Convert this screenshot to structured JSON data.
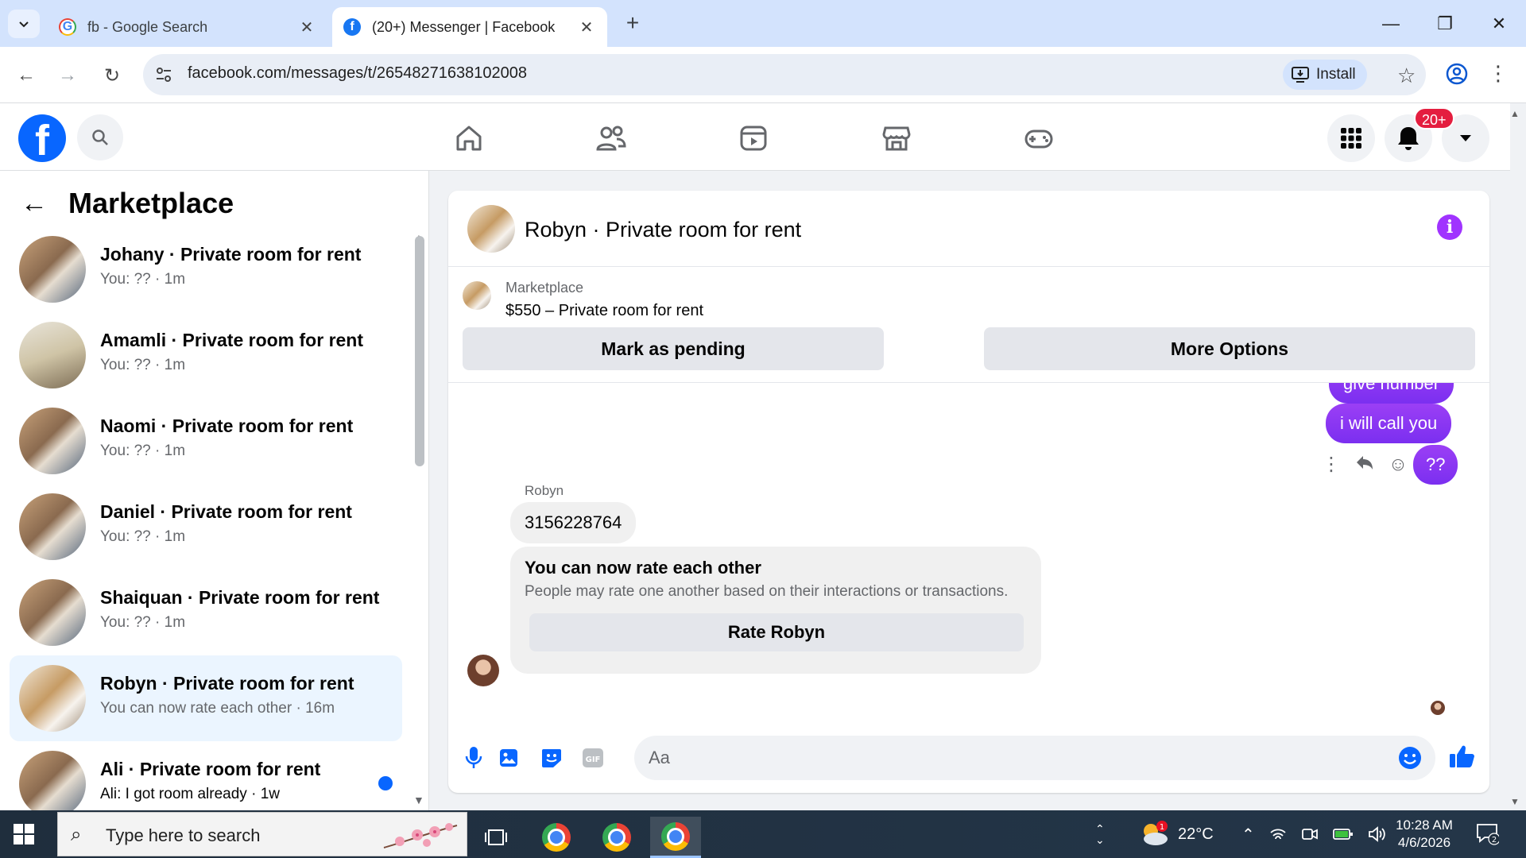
{
  "browser": {
    "tabs": [
      {
        "title": "fb - Google Search",
        "active": false
      },
      {
        "title": "(20+) Messenger | Facebook",
        "active": true
      }
    ],
    "url": "facebook.com/messages/t/26548271638102008",
    "install_label": "Install"
  },
  "fb_nav": {
    "notification_badge": "20+",
    "brand_color": "#0866ff"
  },
  "sidebar": {
    "title": "Marketplace",
    "conversations": [
      {
        "name": "Johany · Private room for rent",
        "preview": "You: ?? · 1m",
        "selected": false,
        "unread": false
      },
      {
        "name": "Amamli · Private room for rent",
        "preview": "You: ?? · 1m",
        "selected": false,
        "unread": false
      },
      {
        "name": "Naomi · Private room for rent",
        "preview": "You: ?? · 1m",
        "selected": false,
        "unread": false
      },
      {
        "name": "Daniel · Private room for rent",
        "preview": "You: ?? · 1m",
        "selected": false,
        "unread": false
      },
      {
        "name": "Shaiquan · Private room for rent",
        "preview": "You: ?? · 1m",
        "selected": false,
        "unread": false
      },
      {
        "name": "Robyn · Private room for rent",
        "preview": "You can now rate each other · 16m",
        "selected": true,
        "unread": false
      },
      {
        "name": "Ali · Private room for rent",
        "preview": "Ali: I got room already · 1w",
        "selected": false,
        "unread": true
      }
    ]
  },
  "chat": {
    "header_title": "Robyn · Private room for rent",
    "listing": {
      "category": "Marketplace",
      "title": "$550 – Private room for rent",
      "pending_button": "Mark as pending",
      "options_button": "More Options"
    },
    "messages": {
      "partial_out": "give number",
      "out_1": "i will call you",
      "out_2": "??",
      "sender": "Robyn",
      "in_1": "3156228764",
      "rate_title": "You can now rate each other",
      "rate_desc": "People may rate one another based on their interactions or transactions.",
      "rate_button": "Rate Robyn"
    },
    "composer_placeholder": "Aa",
    "accent_color": "#8a2be2"
  },
  "taskbar": {
    "search_placeholder": "Type here to search",
    "weather": "22°C",
    "weather_badge": "1",
    "time": "10:28 AM",
    "date": "4/6/2026",
    "notification_count": "2"
  }
}
